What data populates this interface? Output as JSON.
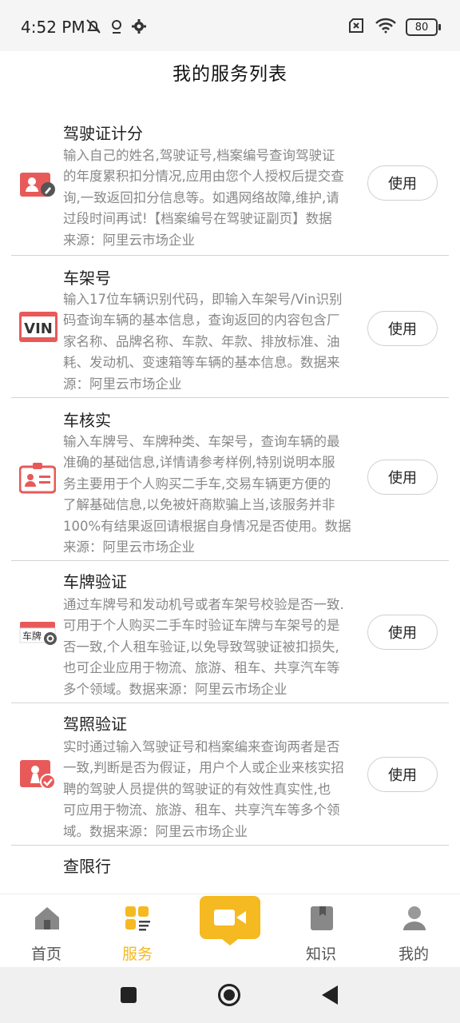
{
  "status_bar": {
    "time": "4:52 PM",
    "battery": "80"
  },
  "header": {
    "title": "我的服务列表"
  },
  "services": [
    {
      "title": "驾驶证计分",
      "description": "输入自己的姓名,驾驶证号,档案编号查询驾驶证的年度累积扣分情况,应用由您个人授权后提交查询,一致返回扣分信息等。如遇网络故障,维护,请过段时间再试!【档案编号在驾驶证副页】数据来源：阿里云市场企业",
      "desc_lines": [
        "输入自己的姓名,驾驶证号,档案编号查询驾驶证",
        "的年度累积扣分情况,应用由您个人授权后提交查",
        "询,一致返回扣分信息等。如遇网络故障,维护,请",
        "过段时间再试!【档案编号在驾驶证副页】数据",
        "来源：阿里云市场企业"
      ],
      "icon": "license-points-icon",
      "button": "使用"
    },
    {
      "title": "车架号",
      "description": "输入17位车辆识别代码，即输入车架号/Vin识别码查询车辆的基本信息，查询返回的内容包含厂家名称、品牌名称、车款、年款、排放标准、油耗、发动机、变速箱等车辆的基本信息。数据来源：阿里云市场企业",
      "desc_lines": [
        "输入17位车辆识别代码，即输入车架号/Vin识别",
        "码查询车辆的基本信息，查询返回的内容包含厂",
        "家名称、品牌名称、车款、年款、排放标准、油",
        "耗、发动机、变速箱等车辆的基本信息。数据来",
        "源：阿里云市场企业"
      ],
      "icon": "vin-icon",
      "icon_text": "VIN",
      "button": "使用"
    },
    {
      "title": "车核实",
      "description": "输入车牌号、车牌种类、车架号，查询车辆的最准确的基础信息,详情请参考样例,特别说明本服务主要用于个人购买二手车,交易车辆更方便的了解基础信息,以免被奸商欺骗上当,该服务并非100%有结果返回请根据自身情况是否使用。数据来源：阿里云市场企业",
      "desc_lines": [
        "输入车牌号、车牌种类、车架号，查询车辆的最",
        "准确的基础信息,详情请参考样例,特别说明本服",
        "务主要用于个人购买二手车,交易车辆更方便的",
        "了解基础信息,以免被奸商欺骗上当,该服务并非",
        "100%有结果返回请根据自身情况是否使用。数据",
        "来源：阿里云市场企业"
      ],
      "icon": "id-card-icon",
      "button": "使用"
    },
    {
      "title": "车牌验证",
      "description": "通过车牌号和发动机号或者车架号校验是否一致.可用于个人购买二手车时验证车牌与车架号的是否一致,个人租车验证,以免导致驾驶证被扣损失,也可企业应用于物流、旅游、租车、共享汽车等多个领域。数据来源：阿里云市场企业",
      "desc_lines": [
        "通过车牌号和发动机号或者车架号校验是否一致.",
        "可用于个人购买二手车时验证车牌与车架号的是",
        "否一致,个人租车验证,以免导致驾驶证被扣损失,",
        "也可企业应用于物流、旅游、租车、共享汽车等",
        "多个领域。数据来源：阿里云市场企业"
      ],
      "icon": "plate-verify-icon",
      "icon_text": "车牌",
      "button": "使用"
    },
    {
      "title": "驾照验证",
      "description": "实时通过输入驾驶证号和档案编来查询两者是否一致,判断是否为假证，用户个人或企业来核实招聘的驾驶人员提供的驾驶证的有效性真实性,也可应用于物流、旅游、租车、共享汽车等多个领域。数据来源：阿里云市场企业",
      "desc_lines": [
        "实时通过输入驾驶证号和档案编来查询两者是否",
        "一致,判断是否为假证，用户个人或企业来核实招",
        "聘的驾驶人员提供的驾驶证的有效性真实性,也",
        "可应用于物流、旅游、租车、共享汽车等多个领",
        "域。数据来源：阿里云市场企业"
      ],
      "icon": "driver-license-verify-icon",
      "button": "使用"
    },
    {
      "title": "查限行",
      "icon": "",
      "button": ""
    }
  ],
  "bottom_nav": {
    "items": [
      {
        "label": "首页",
        "icon": "home-icon"
      },
      {
        "label": "服务",
        "icon": "services-icon",
        "active": true
      },
      {
        "label": "",
        "icon": "video-camera-icon"
      },
      {
        "label": "知识",
        "icon": "knowledge-icon"
      },
      {
        "label": "我的",
        "icon": "profile-icon"
      }
    ]
  },
  "colors": {
    "accent": "#f5b921",
    "icon_red": "#e85a5a",
    "text_muted": "#888888"
  }
}
